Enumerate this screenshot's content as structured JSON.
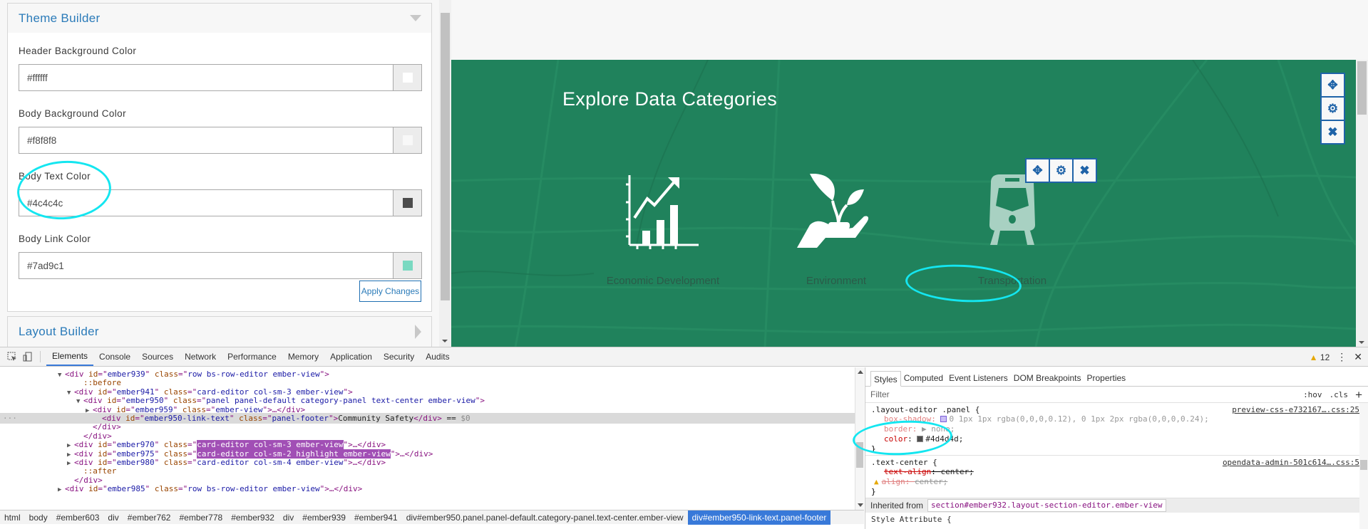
{
  "theme_builder": {
    "title": "Theme Builder",
    "fields": [
      {
        "label": "Header Background Color",
        "value": "#ffffff",
        "swatch": "#ffffff"
      },
      {
        "label": "Body Background Color",
        "value": "#f8f8f8",
        "swatch": "#f8f8f8"
      },
      {
        "label": "Body Text Color",
        "value": "#4c4c4c",
        "swatch": "#4c4c4c"
      },
      {
        "label": "Body Link Color",
        "value": "#7ad9c1",
        "swatch": "#7ad9c1"
      }
    ],
    "apply_label": "Apply Changes"
  },
  "layout_builder": {
    "title": "Layout Builder"
  },
  "preview": {
    "title": "Explore Data Categories",
    "background_color": "#20825c",
    "categories": [
      {
        "label": "Economic Development",
        "icon": "chart-growth-icon"
      },
      {
        "label": "Environment",
        "icon": "plant-in-hand-icon"
      },
      {
        "label": "Transportation",
        "icon": "train-icon"
      }
    ],
    "card_toolbar": [
      "move-icon",
      "gear-icon",
      "close-icon"
    ],
    "row_toolbar": [
      "move-icon",
      "gear-icon",
      "close-icon"
    ]
  },
  "devtools": {
    "tabs": [
      "Elements",
      "Console",
      "Sources",
      "Network",
      "Performance",
      "Memory",
      "Application",
      "Security",
      "Audits"
    ],
    "active_tab": "Elements",
    "warning_count": "12",
    "dom_lines": [
      {
        "indent": 7,
        "tw": "▼",
        "html": [
          [
            "tag",
            "<div "
          ],
          [
            "an",
            "id"
          ],
          [
            "tag",
            "=\""
          ],
          [
            "av",
            "ember939"
          ],
          [
            "tag",
            "\" "
          ],
          [
            "an",
            "class"
          ],
          [
            "tag",
            "=\""
          ],
          [
            "av",
            "row bs-row-editor ember-view"
          ],
          [
            "tag",
            "\">"
          ]
        ]
      },
      {
        "indent": 9,
        "tw": "",
        "html": [
          [
            "pseudo",
            "::before"
          ]
        ]
      },
      {
        "indent": 8,
        "tw": "▼",
        "html": [
          [
            "tag",
            "<div "
          ],
          [
            "an",
            "id"
          ],
          [
            "tag",
            "=\""
          ],
          [
            "av",
            "ember941"
          ],
          [
            "tag",
            "\" "
          ],
          [
            "an",
            "class"
          ],
          [
            "tag",
            "=\""
          ],
          [
            "av",
            "card-editor col-sm-3 ember-view"
          ],
          [
            "tag",
            "\">"
          ]
        ]
      },
      {
        "indent": 9,
        "tw": "▼",
        "html": [
          [
            "tag",
            "<div "
          ],
          [
            "an",
            "id"
          ],
          [
            "tag",
            "=\""
          ],
          [
            "av",
            "ember950"
          ],
          [
            "tag",
            "\" "
          ],
          [
            "an",
            "class"
          ],
          [
            "tag",
            "=\""
          ],
          [
            "av",
            "panel panel-default category-panel text-center ember-view"
          ],
          [
            "tag",
            "\">"
          ]
        ]
      },
      {
        "indent": 10,
        "tw": "▶",
        "html": [
          [
            "tag",
            "<div "
          ],
          [
            "an",
            "id"
          ],
          [
            "tag",
            "=\""
          ],
          [
            "av",
            "ember959"
          ],
          [
            "tag",
            "\" "
          ],
          [
            "an",
            "class"
          ],
          [
            "tag",
            "=\""
          ],
          [
            "av",
            "ember-view"
          ],
          [
            "tag",
            "\">…</div>"
          ]
        ]
      },
      {
        "indent": 11,
        "tw": "",
        "selected": true,
        "html": [
          [
            "tag",
            "<div "
          ],
          [
            "an",
            "id"
          ],
          [
            "tag",
            "=\""
          ],
          [
            "av",
            "ember950-link-text"
          ],
          [
            "tag",
            "\" "
          ],
          [
            "an",
            "class"
          ],
          [
            "tag",
            "=\""
          ],
          [
            "av",
            "panel-footer"
          ],
          [
            "tag",
            "\">"
          ],
          [
            "txt",
            "Community Safety"
          ],
          [
            "tag",
            "</div>"
          ],
          [
            "txt",
            " == "
          ],
          [
            "dim",
            "$0"
          ]
        ]
      },
      {
        "indent": 10,
        "tw": "",
        "html": [
          [
            "tag",
            "</div>"
          ]
        ]
      },
      {
        "indent": 9,
        "tw": "",
        "html": [
          [
            "tag",
            "</div>"
          ]
        ]
      },
      {
        "indent": 8,
        "tw": "▶",
        "html": [
          [
            "tag",
            "<div "
          ],
          [
            "an",
            "id"
          ],
          [
            "tag",
            "=\""
          ],
          [
            "av",
            "ember970"
          ],
          [
            "tag",
            "\" "
          ],
          [
            "an",
            "class"
          ],
          [
            "tag",
            "=\""
          ],
          [
            "hl",
            "card-editor col-sm-3 ember-view"
          ],
          [
            "tag",
            "\">…</div>"
          ]
        ]
      },
      {
        "indent": 8,
        "tw": "▶",
        "html": [
          [
            "tag",
            "<div "
          ],
          [
            "an",
            "id"
          ],
          [
            "tag",
            "=\""
          ],
          [
            "av",
            "ember975"
          ],
          [
            "tag",
            "\" "
          ],
          [
            "an",
            "class"
          ],
          [
            "tag",
            "=\""
          ],
          [
            "hl",
            "card-editor col-sm-2 highlight ember-view"
          ],
          [
            "tag",
            "\">…</div>"
          ]
        ]
      },
      {
        "indent": 8,
        "tw": "▶",
        "html": [
          [
            "tag",
            "<div "
          ],
          [
            "an",
            "id"
          ],
          [
            "tag",
            "=\""
          ],
          [
            "av",
            "ember980"
          ],
          [
            "tag",
            "\" "
          ],
          [
            "an",
            "class"
          ],
          [
            "tag",
            "=\""
          ],
          [
            "av",
            "card-editor col-sm-4 ember-view"
          ],
          [
            "tag",
            "\">…</div>"
          ]
        ]
      },
      {
        "indent": 9,
        "tw": "",
        "html": [
          [
            "pseudo",
            "::after"
          ]
        ]
      },
      {
        "indent": 8,
        "tw": "",
        "html": [
          [
            "tag",
            "</div>"
          ]
        ]
      },
      {
        "indent": 7,
        "tw": "▶",
        "html": [
          [
            "tag",
            "<div "
          ],
          [
            "an",
            "id"
          ],
          [
            "tag",
            "=\""
          ],
          [
            "av",
            "ember985"
          ],
          [
            "tag",
            "\" "
          ],
          [
            "an",
            "class"
          ],
          [
            "tag",
            "=\""
          ],
          [
            "av",
            "row bs-row-editor ember-view"
          ],
          [
            "tag",
            "\">…</div>"
          ]
        ]
      }
    ],
    "breadcrumbs": [
      "html",
      "body",
      "#ember603",
      "div",
      "#ember762",
      "#ember778",
      "#ember932",
      "div",
      "#ember939",
      "#ember941",
      "div#ember950.panel.panel-default.category-panel.text-center.ember-view",
      "div#ember950-link-text.panel-footer"
    ],
    "styles_tabs": [
      "Styles",
      "Computed",
      "Event Listeners",
      "DOM Breakpoints",
      "Properties"
    ],
    "filter_placeholder": "Filter",
    "filter_buttons": [
      ":hov",
      ".cls",
      "+"
    ],
    "rules": [
      {
        "selector": ".layout-editor .panel {",
        "source": "preview-css-e732167….css:25",
        "decls": [
          {
            "prop": "box-shadow",
            "value": "0 1px 1px rgba(0,0,0,0.12), 0 1px 2px rgba(0,0,0,0.24);",
            "faded": true
          },
          {
            "prop": "border",
            "value": "▶ none;",
            "faded": true
          },
          {
            "prop": "color",
            "value": "#4d4d4d;",
            "swatch": "#4d4d4d"
          }
        ]
      },
      {
        "selector": ".text-center {",
        "source": "opendata-admin-501c614….css:5",
        "decls": [
          {
            "prop": "text-align",
            "value": "center;",
            "struck": true
          },
          {
            "prop": "align",
            "value": "center;",
            "struck": true,
            "warning": true,
            "faded": true
          }
        ]
      }
    ],
    "inherited_label": "Inherited from",
    "inherited_selector": "section#ember932.layout-section-editor.ember-view",
    "style_attribute": "Style Attribute {"
  }
}
